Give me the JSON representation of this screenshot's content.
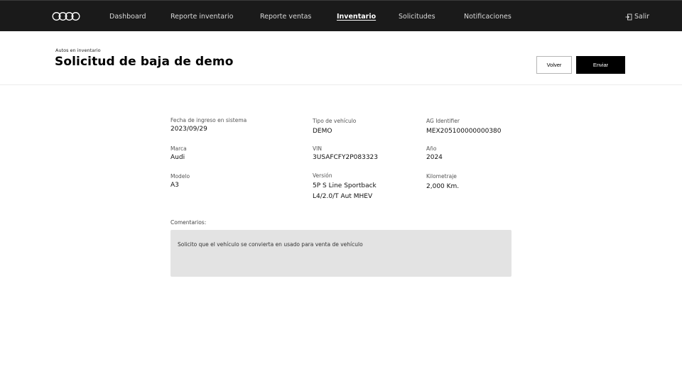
{
  "nav": {
    "items": [
      {
        "label": "Dashboard"
      },
      {
        "label": "Reporte inventario"
      },
      {
        "label": "Reporte ventas"
      },
      {
        "label": "Inventario"
      },
      {
        "label": "Solicitudes"
      },
      {
        "label": "Notificaciones"
      }
    ],
    "active_item": "Inventario",
    "logout_label": "Salir"
  },
  "header": {
    "breadcrumb": "Autos en inventario",
    "title": "Solicitud de baja de demo",
    "back_label": "Volver",
    "send_label": "Enviar"
  },
  "details": {
    "fecha_ingreso": {
      "label": "Fecha de ingreso en sistema",
      "value": "2023/09/29"
    },
    "marca": {
      "label": "Marca",
      "value": "Audi"
    },
    "modelo": {
      "label": "Modelo",
      "value": "A3"
    },
    "tipo_vehiculo": {
      "label": "Tipo de vehículo",
      "value": "DEMO"
    },
    "vin": {
      "label": "VIN",
      "value": "3USAFCFY2P083323"
    },
    "version": {
      "label": "Versión",
      "value_line1": "5P S Line Sportback",
      "value_line2": "L4/2.0/T Aut MHEV"
    },
    "ag_identifier": {
      "label": "AG Identifier",
      "value": "MEX205100000000380"
    },
    "anio": {
      "label": "Año",
      "value": "2024"
    },
    "kilometraje": {
      "label": "Kilometraje",
      "value": "2,000 Km."
    }
  },
  "comments": {
    "label": "Comentarios:",
    "text": "Solicito que el vehículo se convierta en usado para venta de vehículo"
  },
  "colors": {
    "topbar": "#1a1a1a",
    "primary_button": "#000000",
    "comments_bg": "#e3e3e3"
  },
  "icons": {
    "logo": "audi-rings-logo",
    "logout": "logout-icon"
  }
}
